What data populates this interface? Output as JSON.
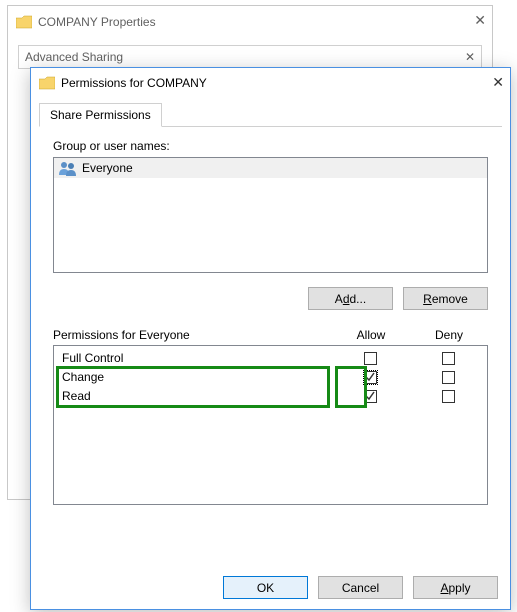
{
  "backWindow": {
    "title": "COMPANY Properties",
    "tabLabel": "Advanced Sharing"
  },
  "dialog": {
    "title": "Permissions for COMPANY",
    "tabs": {
      "sharePermissions": "Share Permissions"
    },
    "groupsLabel": "Group or user names:",
    "users": [
      {
        "name": "Everyone"
      }
    ],
    "buttons": {
      "addPrefix": "A",
      "addAccel": "d",
      "addSuffix": "d...",
      "removeAccel": "R",
      "removeSuffix": "emove"
    },
    "permHeader": {
      "name": "Permissions for Everyone",
      "allow": "Allow",
      "deny": "Deny"
    },
    "perms": [
      {
        "name": "Full Control",
        "allow": false,
        "deny": false
      },
      {
        "name": "Change",
        "allow": true,
        "deny": false
      },
      {
        "name": "Read",
        "allow": true,
        "deny": false
      }
    ],
    "footer": {
      "ok": "OK",
      "cancel": "Cancel",
      "applyAccel": "A",
      "applySuffix": "pply"
    }
  }
}
